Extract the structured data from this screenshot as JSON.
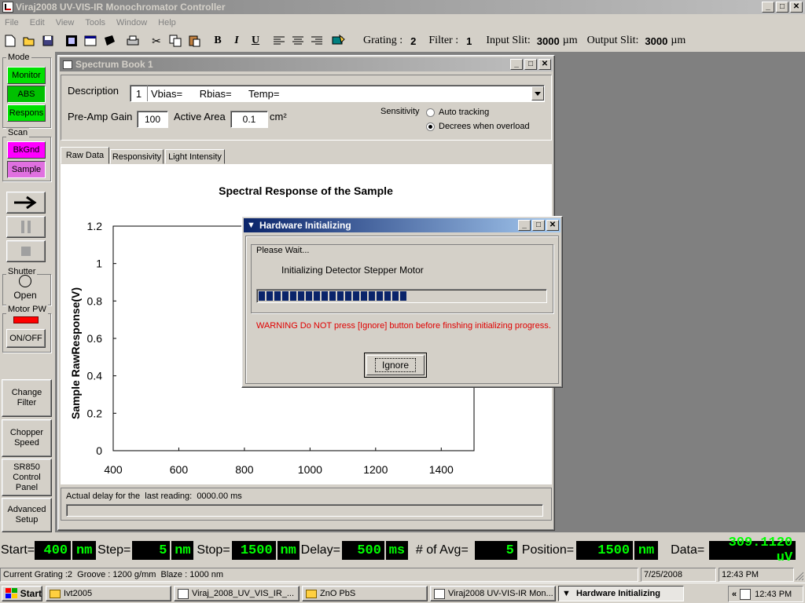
{
  "app": {
    "title": "Viraj2008 UV-VIS-IR Monochromator Controller",
    "menu": [
      "File",
      "Edit",
      "View",
      "Tools",
      "Window",
      "Help"
    ],
    "toolbar": {
      "grating_label": "Grating :",
      "grating_value": "2",
      "filter_label": "Filter :",
      "filter_value": "1",
      "input_slit_label": "Input Slit:",
      "input_slit_value": "3000",
      "input_slit_unit": "µm",
      "output_slit_label": "Output Slit:",
      "output_slit_value": "3000",
      "output_slit_unit": "µm"
    }
  },
  "left_panel": {
    "mode_label": "Mode",
    "monitor": "Monitor",
    "abs": "ABS",
    "respons": "Respons",
    "scan_label": "Scan",
    "bkgnd": "BkGnd",
    "sample": "Sample",
    "shutter_label": "Shutter",
    "shutter_state": "Open",
    "motor_label": "Motor PW",
    "onoff": "ON/OFF",
    "change_filter": "Change Filter",
    "chopper_speed": "Chopper Speed",
    "sr850": "SR850 Control Panel",
    "advanced_setup": "Advanced Setup"
  },
  "spectrum": {
    "title": "Spectrum Book 1",
    "description_label": "Description",
    "description_index": "1",
    "description_value": "Vbias=      Rbias=      Temp=",
    "preamp_label": "Pre-Amp Gain",
    "preamp_value": "100",
    "area_label": "Active Area",
    "area_value": "0.1",
    "area_unit": "cm²",
    "sensitivity_label": "Sensitivity",
    "auto_tracking": "Auto tracking",
    "decrees": "Decrees when overload",
    "tabs": [
      "Raw Data",
      "Responsivity",
      "Light Intensity"
    ],
    "delay_text": "Actual delay for the  last reading:  0000.00 ms"
  },
  "chart_data": {
    "type": "line",
    "title": "Spectral Response of the Sample",
    "ylabel": "Sample RawResponse(V)",
    "xlabel": "",
    "xlim": [
      400,
      1500
    ],
    "ylim": [
      0,
      1.2
    ],
    "xticks": [
      "400",
      "600",
      "800",
      "1000",
      "1200",
      "1400"
    ],
    "yticks": [
      "0",
      "0.2",
      "0.4",
      "0.6",
      "0.8",
      "1",
      "1.2"
    ],
    "series": []
  },
  "dialog": {
    "title": "Hardware Initializing",
    "group_label": "Please Wait...",
    "message": "Initializing Detector Stepper Motor",
    "progress": 0.52,
    "warning": "WARNING Do NOT press [Ignore] button before finshing initializing progress.",
    "ignore": "Ignore"
  },
  "bottom": {
    "start_label": "Start=",
    "start_value": "400",
    "start_unit": "nm",
    "step_label": "Step=",
    "step_value": "5",
    "step_unit": "nm",
    "stop_label": "Stop=",
    "stop_value": "1500",
    "stop_unit": "nm",
    "delay_label": "Delay=",
    "delay_value": "500",
    "delay_unit": "ms",
    "avg_label": "# of Avg=",
    "avg_value": "5",
    "pos_label": "Position=",
    "pos_value": "1500",
    "pos_unit": "nm",
    "data_label": "Data=",
    "data_value": "309.1120 uV"
  },
  "status": {
    "grating_info": "Current Grating :2  Groove : 1200 g/mm  Blaze : 1000 nm",
    "date": "7/25/2008",
    "time": "12:43 PM"
  },
  "taskbar": {
    "start": "Start",
    "items": [
      "Ivt2005",
      "Viraj_2008_UV_VIS_IR_...",
      "ZnO PbS",
      "Viraj2008 UV-VIS-IR Mon...",
      "Hardware Initializing"
    ],
    "tray_chevron": "«",
    "clock": "12:43 PM"
  },
  "colors": {
    "lcd_green": "#00ff00",
    "mode_green": "#00e000",
    "scan_magenta": "#ff00ff",
    "motor_red": "#ff0000",
    "warning_red": "#e00000",
    "progress_blue": "#0a246a"
  }
}
